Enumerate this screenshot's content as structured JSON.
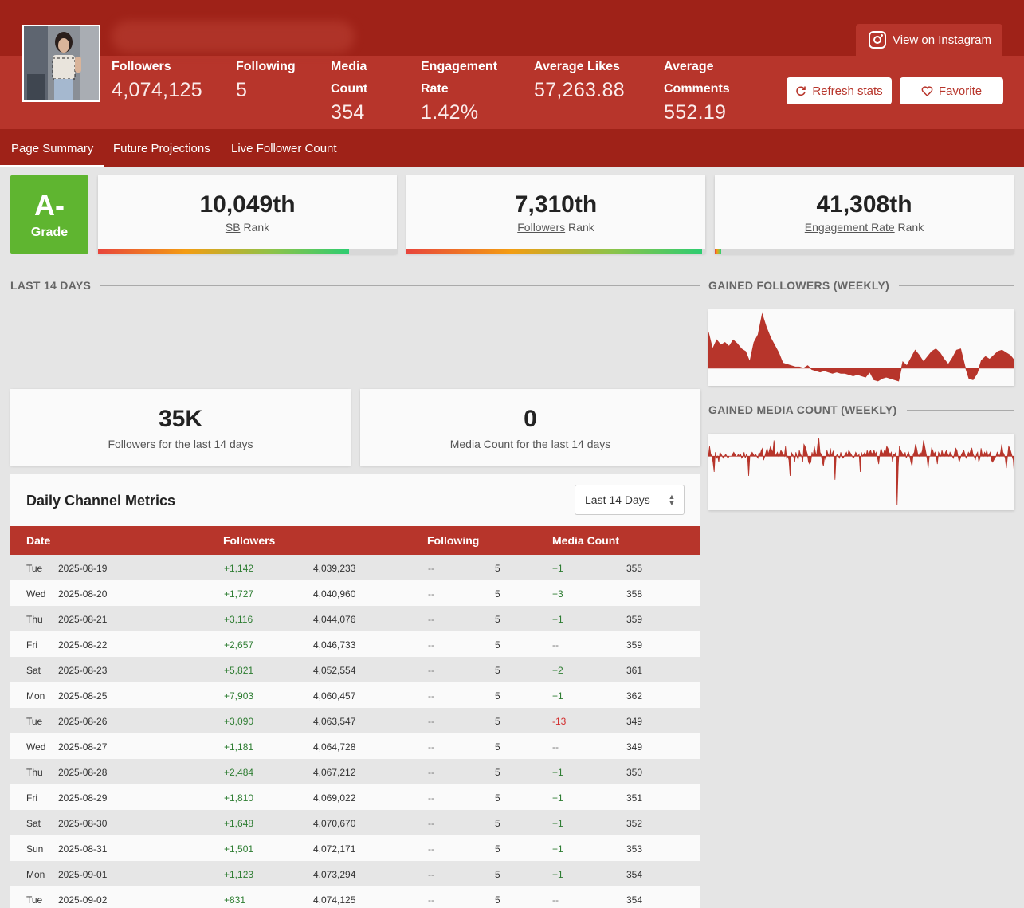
{
  "header": {
    "stats": [
      {
        "label": "Followers",
        "value": "4,074,125"
      },
      {
        "label": "Following",
        "value": "5"
      },
      {
        "label": "Media Count",
        "value": "354"
      },
      {
        "label": "Engagement Rate",
        "value": "1.42%"
      },
      {
        "label": "Average Likes",
        "value": "57,263.88"
      },
      {
        "label": "Average Comments",
        "value": "552.19"
      }
    ],
    "view_on_instagram": "View on Instagram",
    "refresh_label": "Refresh stats",
    "favorite_label": "Favorite"
  },
  "tabs": [
    "Page Summary",
    "Future Projections",
    "Live Follower Count"
  ],
  "grade": {
    "value": "A-",
    "label": "Grade"
  },
  "ranks": [
    {
      "value": "10,049th",
      "link": "SB",
      "suffix": "Rank",
      "fraction": 0.84
    },
    {
      "value": "7,310th",
      "link": "Followers",
      "suffix": "Rank",
      "fraction": 0.99
    },
    {
      "value": "41,308th",
      "link": "Engagement Rate",
      "suffix": "Rank",
      "fraction": 0.02
    }
  ],
  "sections": {
    "last14": "LAST 14 DAYS",
    "gained_followers": "GAINED FOLLOWERS (WEEKLY)",
    "gained_media": "GAINED MEDIA COUNT (WEEKLY)"
  },
  "summary": [
    {
      "value": "35K",
      "desc": "Followers for the last 14 days"
    },
    {
      "value": "0",
      "desc": "Media Count for the last 14 days"
    }
  ],
  "metrics": {
    "title": "Daily Channel Metrics",
    "range": "Last 14 Days",
    "columns": [
      "Date",
      "Followers",
      "Following",
      "Media Count"
    ],
    "rows": [
      [
        "Tue",
        "2025-08-19",
        "+1,142",
        "4,039,233",
        "--",
        "5",
        "+1",
        "355"
      ],
      [
        "Wed",
        "2025-08-20",
        "+1,727",
        "4,040,960",
        "--",
        "5",
        "+3",
        "358"
      ],
      [
        "Thu",
        "2025-08-21",
        "+3,116",
        "4,044,076",
        "--",
        "5",
        "+1",
        "359"
      ],
      [
        "Fri",
        "2025-08-22",
        "+2,657",
        "4,046,733",
        "--",
        "5",
        "--",
        "359"
      ],
      [
        "Sat",
        "2025-08-23",
        "+5,821",
        "4,052,554",
        "--",
        "5",
        "+2",
        "361"
      ],
      [
        "Mon",
        "2025-08-25",
        "+7,903",
        "4,060,457",
        "--",
        "5",
        "+1",
        "362"
      ],
      [
        "Tue",
        "2025-08-26",
        "+3,090",
        "4,063,547",
        "--",
        "5",
        "-13",
        "349"
      ],
      [
        "Wed",
        "2025-08-27",
        "+1,181",
        "4,064,728",
        "--",
        "5",
        "--",
        "349"
      ],
      [
        "Thu",
        "2025-08-28",
        "+2,484",
        "4,067,212",
        "--",
        "5",
        "+1",
        "350"
      ],
      [
        "Fri",
        "2025-08-29",
        "+1,810",
        "4,069,022",
        "--",
        "5",
        "+1",
        "351"
      ],
      [
        "Sat",
        "2025-08-30",
        "+1,648",
        "4,070,670",
        "--",
        "5",
        "+1",
        "352"
      ],
      [
        "Sun",
        "2025-08-31",
        "+1,501",
        "4,072,171",
        "--",
        "5",
        "+1",
        "353"
      ],
      [
        "Mon",
        "2025-09-01",
        "+1,123",
        "4,073,294",
        "--",
        "5",
        "+1",
        "354"
      ],
      [
        "Tue",
        "2025-09-02",
        "+831",
        "4,074,125",
        "--",
        "5",
        "--",
        "354"
      ]
    ]
  },
  "colors": {
    "brand": "#b7352b",
    "brand_dark": "#9f2218",
    "grade": "#5fb530",
    "positive": "#2e7d32",
    "negative": "#d32f2f"
  },
  "chart_data": [
    {
      "type": "area",
      "title": "GAINED FOLLOWERS (WEEKLY)",
      "values": [
        28,
        15,
        22,
        18,
        20,
        17,
        22,
        19,
        15,
        13,
        5,
        20,
        26,
        42,
        32,
        24,
        18,
        12,
        4,
        3,
        2,
        1,
        1,
        0,
        2,
        -1,
        -2,
        -3,
        -2,
        -3,
        -4,
        -3,
        -4,
        -4,
        -5,
        -6,
        -5,
        -6,
        -7,
        -3,
        -9,
        -10,
        -8,
        -7,
        -8,
        -9,
        -10,
        5,
        2,
        8,
        14,
        10,
        5,
        9,
        13,
        15,
        12,
        7,
        3,
        8,
        14,
        15,
        2,
        -8,
        -9,
        -4,
        6,
        9,
        7,
        10,
        13,
        14,
        12,
        10,
        6
      ]
    },
    {
      "type": "area",
      "title": "GAINED MEDIA COUNT (WEEKLY)",
      "values": [
        0,
        5,
        1,
        0,
        -3,
        -8,
        2,
        -1,
        0,
        -3,
        2,
        1,
        0,
        -1,
        0,
        1,
        0,
        -1,
        0,
        0,
        0,
        1,
        2,
        1,
        0,
        0,
        1,
        0,
        1,
        -1,
        0,
        2,
        -1,
        1,
        0,
        -10,
        0,
        1,
        2,
        1,
        0,
        1,
        0,
        -1,
        2,
        1,
        3,
        4,
        -2,
        0,
        2,
        4,
        1,
        3,
        5,
        3,
        2,
        8,
        0,
        1,
        2,
        0,
        1,
        3,
        2,
        1,
        0,
        5,
        -1,
        0,
        -2,
        -10,
        2,
        1,
        0,
        -3,
        2,
        0,
        -2,
        3,
        1,
        0,
        -3,
        6,
        5,
        3,
        1,
        -3,
        -4,
        -3,
        2,
        0,
        5,
        2,
        0,
        6,
        9,
        2,
        1,
        -3,
        -5,
        0,
        -2,
        3,
        1,
        0,
        4,
        0,
        2,
        3,
        -12,
        0,
        1,
        0,
        -1,
        2,
        0,
        -1,
        0,
        1,
        2,
        0,
        3,
        2,
        1,
        0,
        -1,
        0,
        2,
        1,
        0,
        1,
        -8,
        2,
        0,
        1,
        2,
        0,
        3,
        1,
        2,
        3,
        1,
        2,
        3,
        1,
        2,
        -1,
        -4,
        1,
        4,
        2,
        1,
        3,
        2,
        5,
        4,
        2,
        1,
        2,
        -3,
        1,
        1,
        2,
        -25,
        -5,
        5,
        3,
        2,
        1,
        0,
        2,
        -1,
        1,
        2,
        0,
        -3,
        -5,
        1,
        2,
        6,
        4,
        1,
        0,
        2,
        1,
        3,
        8,
        5,
        2,
        -1,
        -6,
        0,
        0,
        4,
        3,
        1,
        2,
        0,
        -4,
        2,
        1,
        0,
        3,
        1,
        0,
        2,
        3,
        1,
        0,
        2,
        1,
        0,
        -1,
        2,
        4,
        3,
        0,
        -3,
        -1,
        1,
        2,
        3,
        1,
        -1,
        0,
        2,
        1,
        3,
        4,
        1,
        0,
        -2,
        1,
        2,
        -3,
        -1,
        4,
        1,
        0,
        2,
        1,
        3,
        0,
        1,
        2,
        -2,
        -3,
        -2,
        -1,
        0,
        2,
        1,
        0,
        2,
        6,
        2,
        1,
        -1,
        -6,
        0,
        5,
        4,
        2,
        0,
        -2,
        -10
      ]
    }
  ]
}
